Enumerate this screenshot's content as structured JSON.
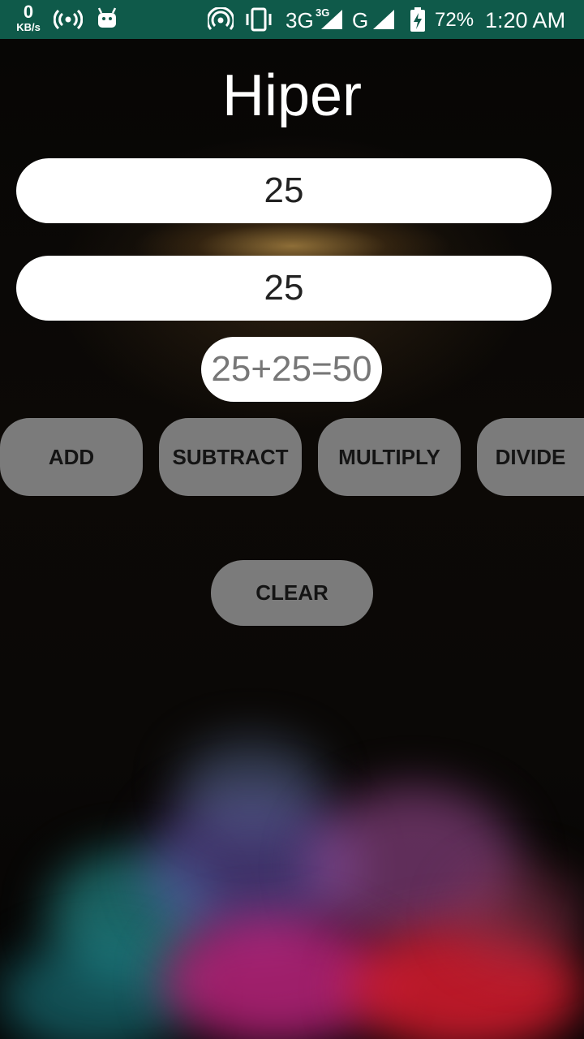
{
  "status_bar": {
    "net_speed": "0",
    "net_unit": "KB/s",
    "network_type": "3G",
    "network_sup": "3G",
    "network_type2": "G",
    "battery": "72%",
    "time": "1:20 AM"
  },
  "app": {
    "title": "Hiper",
    "input1": "25",
    "input2": "25",
    "result": "25+25=50"
  },
  "buttons": {
    "add": "ADD",
    "subtract": "SUBTRACT",
    "multiply": "MULTIPLY",
    "divide": "DIVIDE",
    "clear": "CLEAR"
  },
  "colors": {
    "status_bar": "#0f5a4a",
    "button": "#7b7b7b",
    "field": "#ffffff"
  }
}
